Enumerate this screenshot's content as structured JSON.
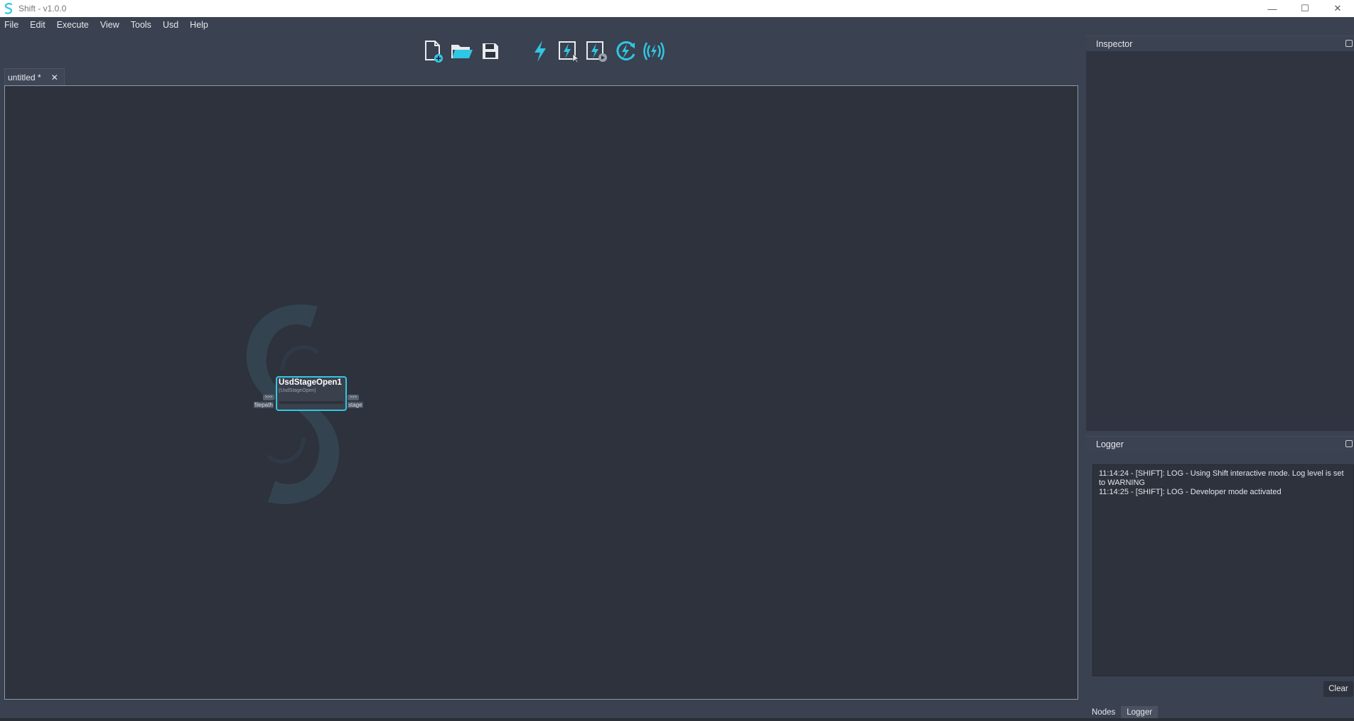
{
  "window": {
    "title": "Shift - v1.0.0",
    "minimize": "—",
    "maximize": "☐",
    "close": "✕"
  },
  "menu": [
    "File",
    "Edit",
    "Execute",
    "View",
    "Tools",
    "Usd",
    "Help"
  ],
  "toolbar": {
    "icons": [
      "new-file-icon",
      "open-folder-icon",
      "save-icon",
      "execute-icon",
      "execute-selected-icon",
      "execute-scheduled-icon",
      "execute-refresh-icon",
      "execute-broadcast-icon"
    ],
    "accent": "#2fc7e3"
  },
  "tab": {
    "label": "untitled *",
    "close": "✕"
  },
  "graph": {
    "node": {
      "title": "UsdStageOpen1",
      "type": "(UsdStageOpen)",
      "input_port": "filepath",
      "output_port": "stage",
      "port_arrow": ">>>"
    },
    "highlight": "#34c6e0"
  },
  "inspector": {
    "title": "Inspector"
  },
  "logger": {
    "title": "Logger",
    "lines": [
      "11:14:24 - [SHIFT]: LOG - Using Shift interactive mode. Log level is set",
      "to WARNING",
      "11:14:25 - [SHIFT]: LOG - Developer mode activated"
    ],
    "clear_label": "Clear"
  },
  "dock_tabs": {
    "nodes": "Nodes",
    "logger": "Logger"
  }
}
